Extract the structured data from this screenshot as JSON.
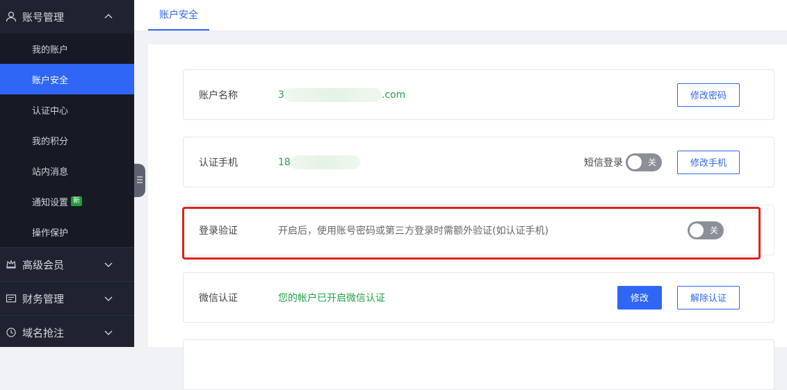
{
  "sidebar": {
    "account_section": "账号管理",
    "items": [
      {
        "label": "我的账户"
      },
      {
        "label": "账户安全"
      },
      {
        "label": "认证中心"
      },
      {
        "label": "我的积分"
      },
      {
        "label": "站内消息"
      },
      {
        "label": "通知设置",
        "badge": "新"
      },
      {
        "label": "操作保护"
      }
    ],
    "vip_section": "高级会员",
    "finance_section": "财务管理",
    "domain_section": "域名抢注"
  },
  "tabs": [
    {
      "label": "账户安全"
    }
  ],
  "cards": {
    "account": {
      "label": "账户名称",
      "value_prefix": "3",
      "value_suffix": ".com",
      "button": "修改密码"
    },
    "phone": {
      "label": "认证手机",
      "value_prefix": "18",
      "sms_label": "短信登录",
      "toggle": "关",
      "button": "修改手机"
    },
    "login_verify": {
      "label": "登录验证",
      "desc": "开启后，使用账号密码或第三方登录时需额外验证(如认证手机)",
      "toggle": "关"
    },
    "wechat": {
      "label": "微信认证",
      "value": "您的帐户已开启微信认证",
      "btn_primary": "修改",
      "btn_secondary": "解除认证"
    }
  },
  "colors": {
    "accent": "#2f66f6",
    "success": "#23a046",
    "highlight": "#e0211b"
  }
}
